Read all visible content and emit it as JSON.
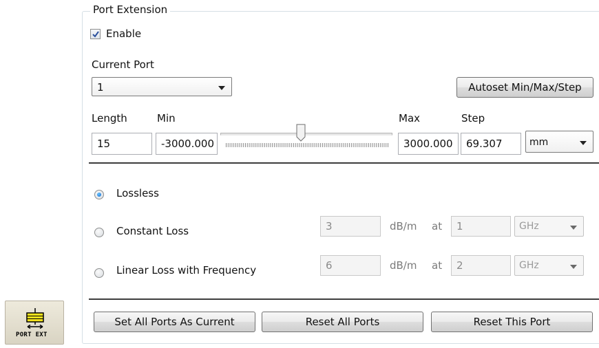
{
  "group": {
    "title": "Port Extension"
  },
  "enable": {
    "label": "Enable",
    "checked": true
  },
  "current_port": {
    "label": "Current Port",
    "value": "1"
  },
  "autoset_button": "Autoset Min/Max/Step",
  "length": {
    "label": "Length",
    "value": "15"
  },
  "min": {
    "label": "Min",
    "value": "-3000.000"
  },
  "max": {
    "label": "Max",
    "value": "3000.000"
  },
  "step": {
    "label": "Step",
    "value": "69.307"
  },
  "unit": {
    "value": "mm"
  },
  "slider": {
    "level": 0.5,
    "tick_count": 85
  },
  "loss": {
    "lossless": {
      "label": "Lossless",
      "selected": true
    },
    "constant": {
      "label": "Constant Loss",
      "value": "3",
      "unit": "dB/m",
      "at": "at",
      "freq": "1",
      "freq_unit": "GHz",
      "selected": false
    },
    "linear": {
      "label": "Linear Loss with Frequency",
      "value": "6",
      "unit": "dB/m",
      "at": "at",
      "freq": "2",
      "freq_unit": "GHz",
      "selected": false
    }
  },
  "buttons": {
    "set_all": "Set All Ports As Current",
    "reset_all": "Reset All Ports",
    "reset_this": "Reset This Port"
  },
  "toolbar_icon": {
    "label": "PORT EXT",
    "icon": "port-extension-icon"
  },
  "colors": {
    "radio_selected": "#1166cc",
    "icon_yellow": "#f3e21b"
  }
}
